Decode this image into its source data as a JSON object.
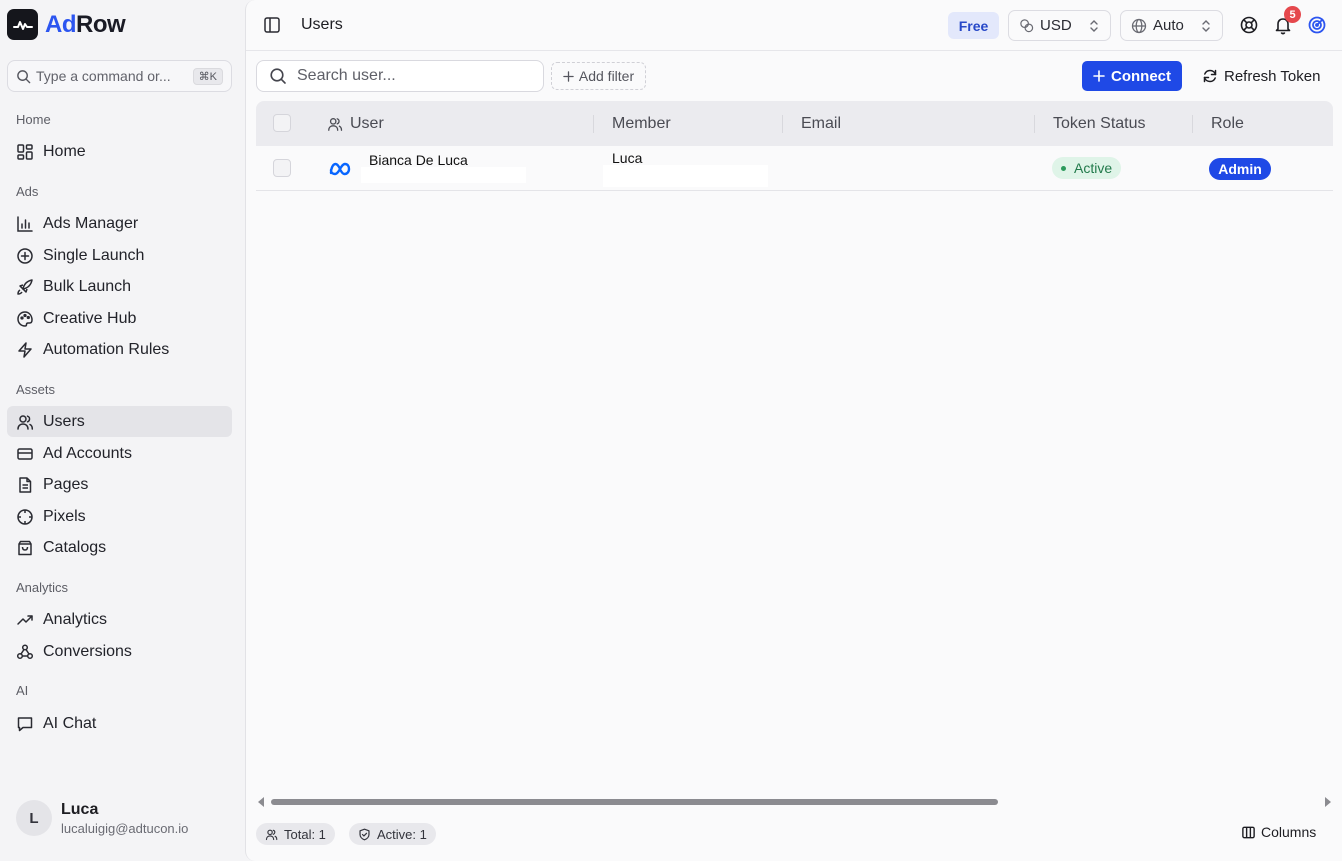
{
  "brand": {
    "name_part1": "Ad",
    "name_part2": "Row"
  },
  "command": {
    "placeholder": "Type a command or...",
    "shortcut": "⌘K"
  },
  "sidebar": {
    "sections": {
      "home": "Home",
      "ads": "Ads",
      "assets": "Assets",
      "analytics": "Analytics",
      "ai": "AI"
    },
    "items": {
      "home": "Home",
      "ads_manager": "Ads Manager",
      "single_launch": "Single Launch",
      "bulk_launch": "Bulk Launch",
      "creative_hub": "Creative Hub",
      "automation_rules": "Automation Rules",
      "users": "Users",
      "ad_accounts": "Ad Accounts",
      "pages": "Pages",
      "pixels": "Pixels",
      "catalogs": "Catalogs",
      "analytics": "Analytics",
      "conversions": "Conversions",
      "ai_chat": "AI Chat"
    },
    "active_item": "users",
    "user": {
      "initial": "L",
      "name": "Luca",
      "email": "lucaluigig@adtucon.io"
    }
  },
  "header": {
    "title": "Users",
    "plan_badge": "Free",
    "currency": "USD",
    "language": "Auto",
    "notification_count": "5"
  },
  "toolbar": {
    "search_placeholder": "Search user...",
    "add_filter_label": "Add filter",
    "connect_label": "Connect",
    "refresh_label": "Refresh Token"
  },
  "table": {
    "columns": {
      "user": "User",
      "member": "Member",
      "email": "Email",
      "token_status": "Token Status",
      "role": "Role"
    },
    "rows": [
      {
        "user": "Bianca De Luca",
        "platform_icon": "meta-icon",
        "member": "Luca",
        "email": "",
        "token_status": "Active",
        "role": "Admin"
      }
    ]
  },
  "footer": {
    "total_label": "Total: 1",
    "active_label": "Active: 1",
    "columns_label": "Columns"
  },
  "colors": {
    "accent": "#1f49e6",
    "brand_blue": "#2c55f0",
    "status_active_bg": "#dff4e8",
    "status_active_text": "#227a4b",
    "notification": "#e5484d"
  }
}
